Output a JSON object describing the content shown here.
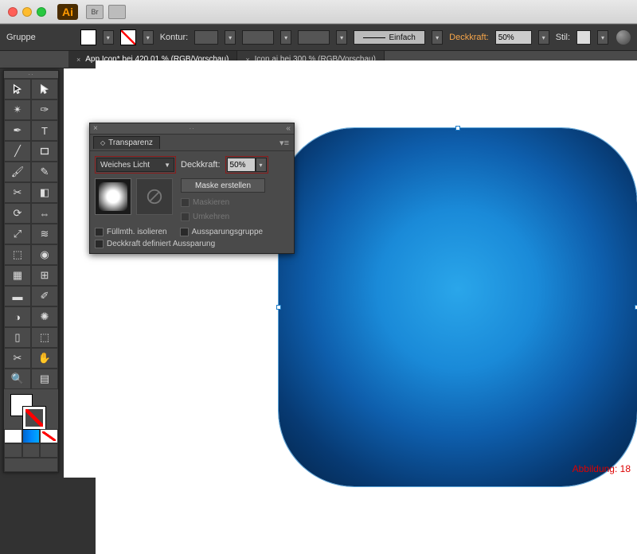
{
  "titlebar": {
    "app": "Ai"
  },
  "controlbar": {
    "selection_label": "Gruppe",
    "kontur_label": "Kontur:",
    "stroke_style_label": "Einfach",
    "deckkraft_label": "Deckkraft:",
    "deckkraft_value": "50%",
    "stil_label": "Stil:"
  },
  "tabs": [
    {
      "label": "App Icon* bei 420,01 % (RGB/Vorschau)",
      "active": true
    },
    {
      "label": "Icon.ai bei 300 % (RGB/Vorschau)",
      "active": false
    }
  ],
  "panel": {
    "title": "Transparenz",
    "blend_mode": "Weiches Licht",
    "deckkraft_label": "Deckkraft:",
    "deckkraft_value": "50%",
    "mask_create": "Maske erstellen",
    "mask_maskieren": "Maskieren",
    "mask_umkehren": "Umkehren",
    "fill_isolate": "Füllmth. isolieren",
    "aussparung_group": "Aussparungsgruppe",
    "deckkraft_def": "Deckkraft definiert Aussparung"
  },
  "figure_label": "Abbildung: 18"
}
